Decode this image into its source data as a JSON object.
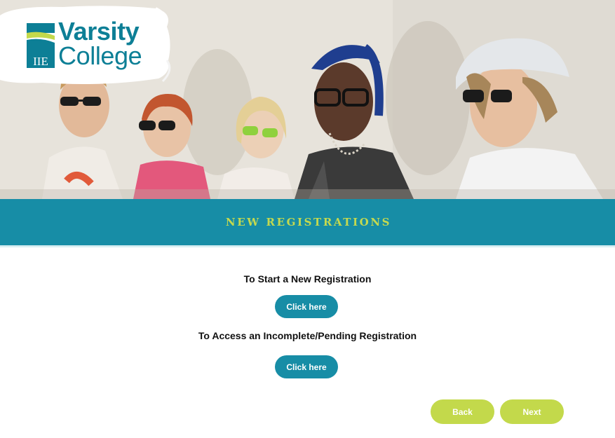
{
  "logo": {
    "badge_text": "IIE",
    "line1": "Varsity",
    "line2": "College"
  },
  "banner": {
    "title": "NEW REGISTRATIONS"
  },
  "registration": {
    "new_prompt": "To Start a New Registration",
    "new_button": "Click here",
    "pending_prompt": "To Access an Incomplete/Pending Registration",
    "pending_button": "Click here"
  },
  "navigation": {
    "back_label": "Back",
    "next_label": "Next"
  },
  "colors": {
    "brand_teal": "#178da6",
    "accent_green": "#c3d94b",
    "logo_teal": "#0d7f96"
  }
}
